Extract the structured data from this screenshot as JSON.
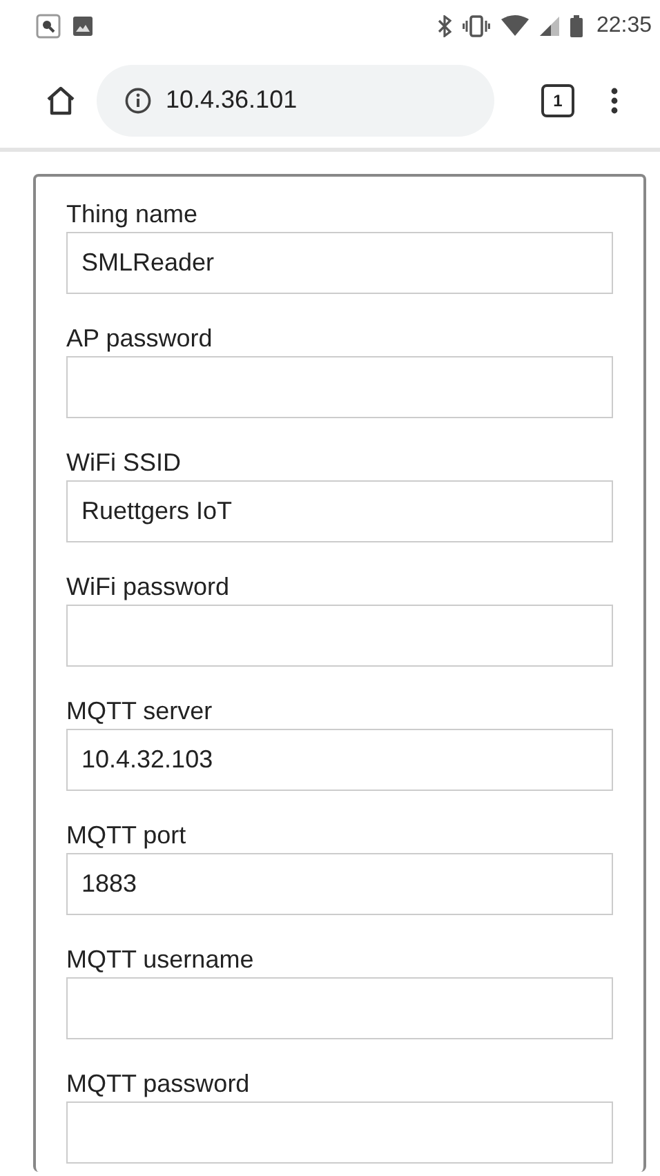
{
  "status_bar": {
    "time": "22:35"
  },
  "browser": {
    "address": "10.4.36.101",
    "tab_count": "1"
  },
  "form": {
    "fields": [
      {
        "label": "Thing name",
        "value": "SMLReader"
      },
      {
        "label": "AP password"
      },
      {
        "label": "WiFi SSID",
        "value": "Ruettgers IoT"
      },
      {
        "label": "WiFi password"
      },
      {
        "label": "MQTT server",
        "value": "10.4.32.103"
      },
      {
        "label": "MQTT port",
        "value": "1883"
      },
      {
        "label": "MQTT username"
      },
      {
        "label": "MQTT password"
      }
    ]
  }
}
